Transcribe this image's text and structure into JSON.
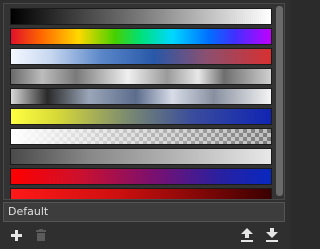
{
  "preset_name": "Default",
  "gradients": [
    {
      "name": "black-to-white"
    },
    {
      "name": "spectrum"
    },
    {
      "name": "white-blue-red"
    },
    {
      "name": "silver"
    },
    {
      "name": "chrome"
    },
    {
      "name": "yellow-to-blue"
    },
    {
      "name": "white-to-transparent"
    },
    {
      "name": "gray-bands"
    },
    {
      "name": "red-to-blue"
    },
    {
      "name": "red-black"
    }
  ],
  "toolbar": {
    "add_icon": "plus-icon",
    "delete_icon": "trash-icon",
    "import_icon": "upload-icon",
    "export_icon": "download-icon"
  },
  "colors": {
    "icon": "#e6e6e6",
    "icon_disabled": "#5b5b5b"
  }
}
